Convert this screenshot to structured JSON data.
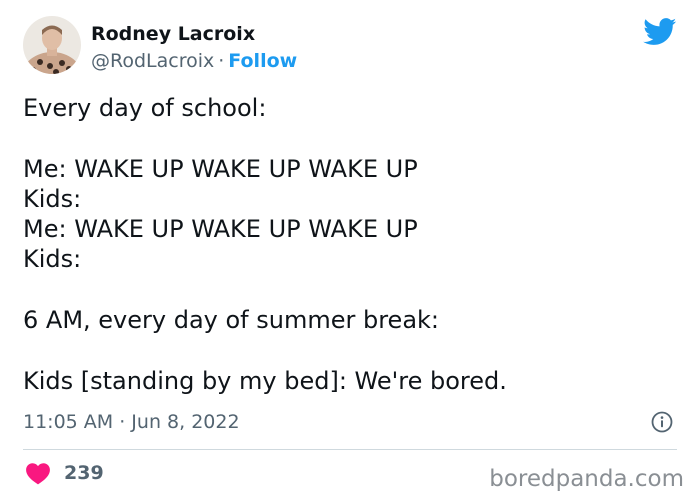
{
  "author": {
    "display_name": "Rodney Lacroix",
    "handle": "@RodLacroix",
    "separator": "·",
    "follow_label": "Follow"
  },
  "tweet": {
    "lines": [
      "Every day of school:",
      "",
      "Me: WAKE UP WAKE UP WAKE UP",
      "Kids:",
      "Me: WAKE UP WAKE UP WAKE UP",
      "Kids:",
      "",
      "6 AM, every day of summer break:",
      "",
      "Kids [standing by my bed]: We're bored."
    ],
    "timestamp": "11:05 AM · Jun 8, 2022"
  },
  "engagement": {
    "like_count": "239"
  },
  "watermark": "boredpanda.com",
  "icons": {
    "brand": "twitter-bird-icon",
    "info": "info-icon",
    "like": "heart-icon"
  },
  "colors": {
    "accent": "#1d9bf0",
    "heart": "#f91880",
    "secondary_text": "#536471"
  }
}
